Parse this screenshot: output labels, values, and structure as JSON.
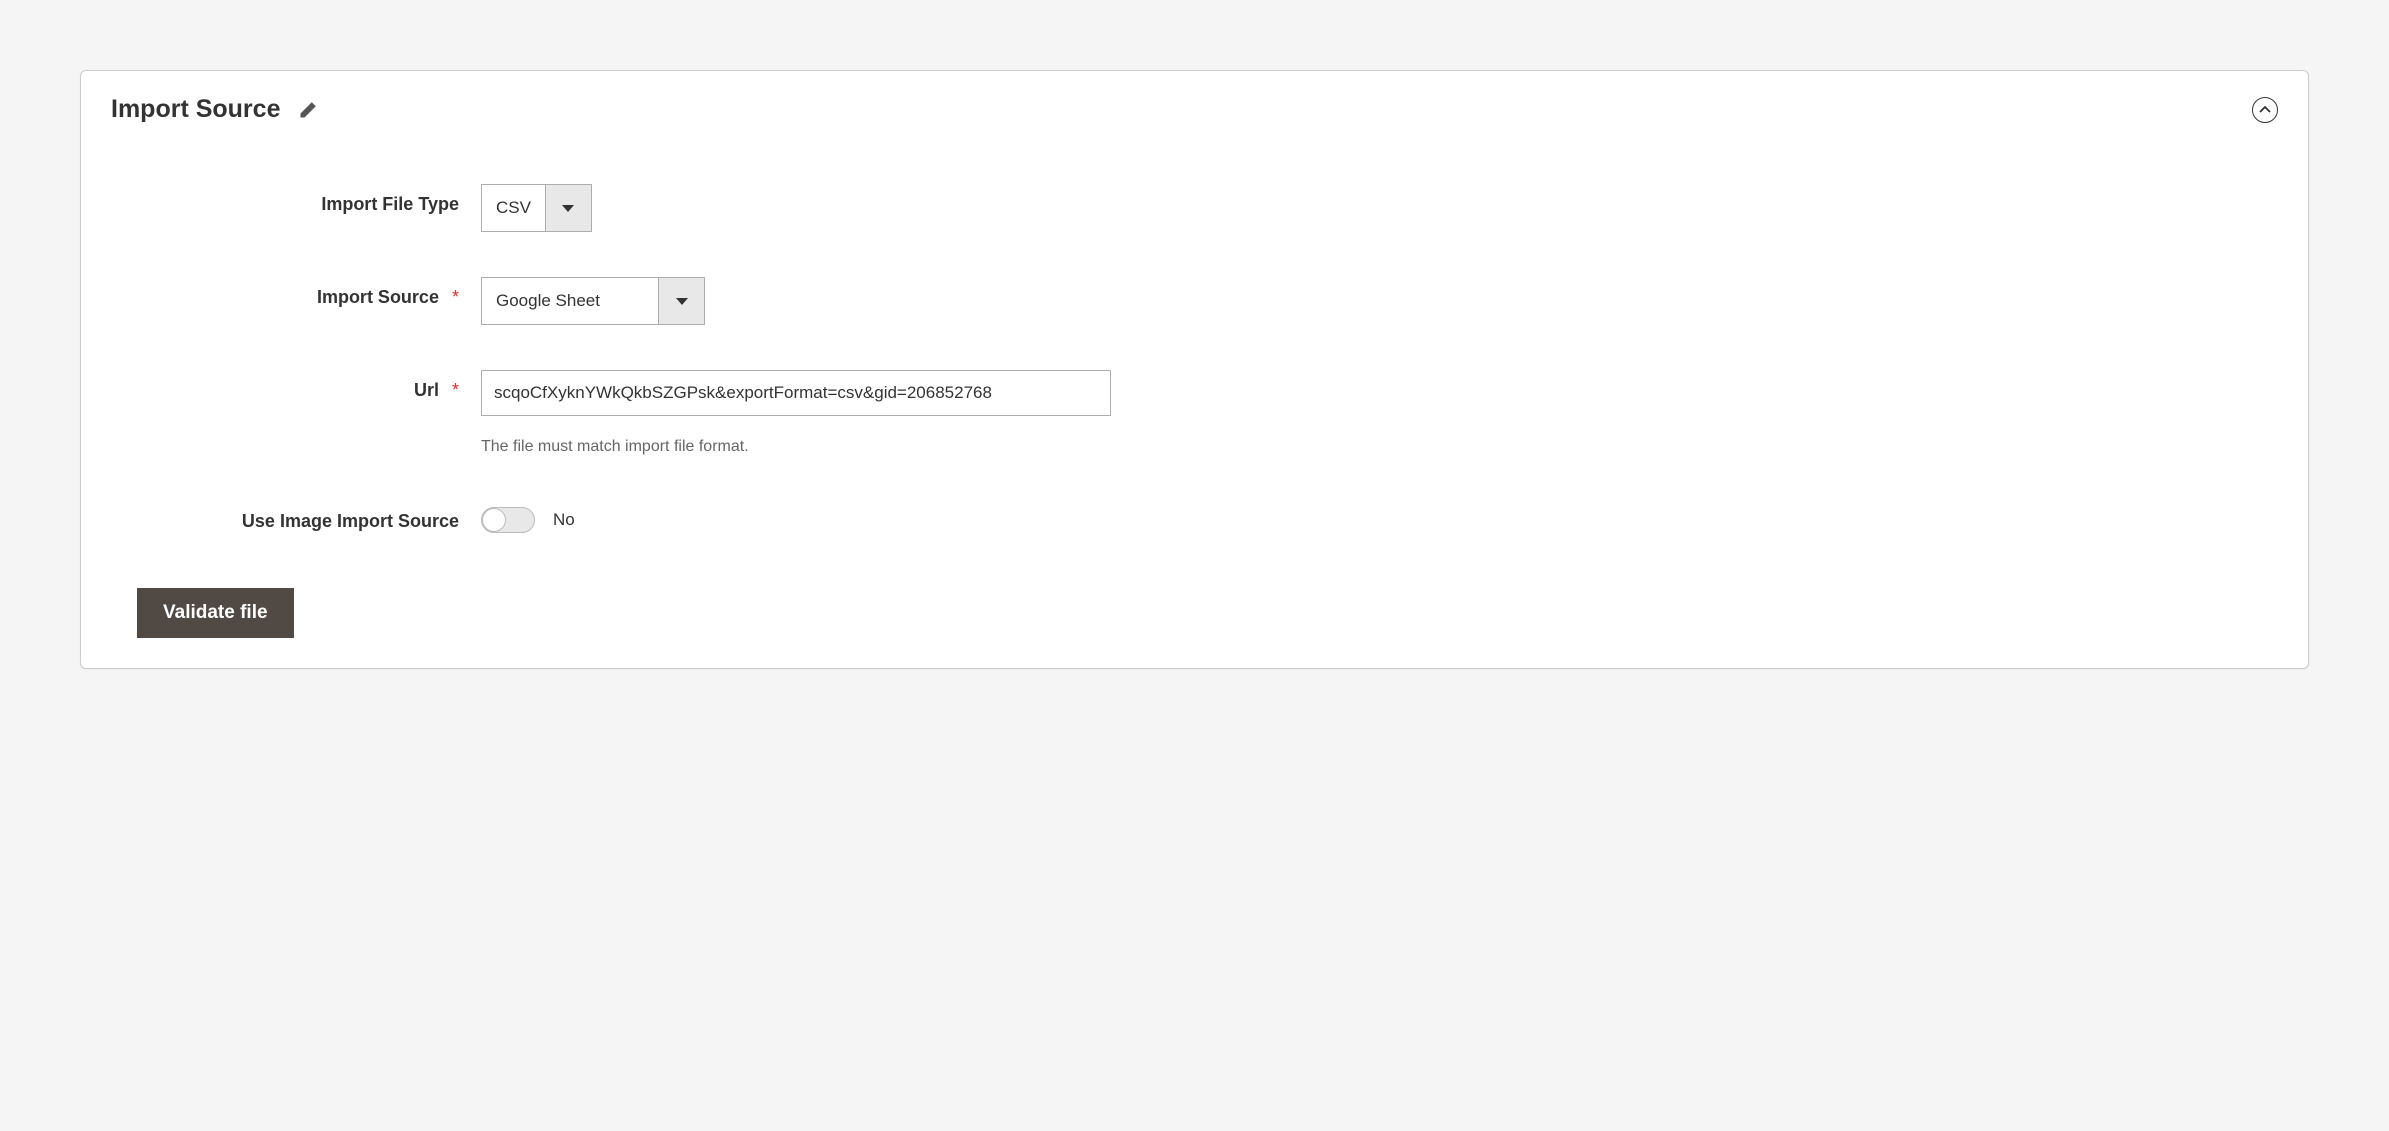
{
  "panel": {
    "title": "Import Source"
  },
  "fields": {
    "fileType": {
      "label": "Import File Type",
      "value": "CSV"
    },
    "importSource": {
      "label": "Import Source",
      "value": "Google Sheet"
    },
    "url": {
      "label": "Url",
      "value": "scqoCfXyknYWkQkbSZGPsk&exportFormat=csv&gid=206852768",
      "hint": "The file must match import file format."
    },
    "useImageImport": {
      "label": "Use Image Import Source",
      "value": "No"
    }
  },
  "buttons": {
    "validate": "Validate file"
  }
}
